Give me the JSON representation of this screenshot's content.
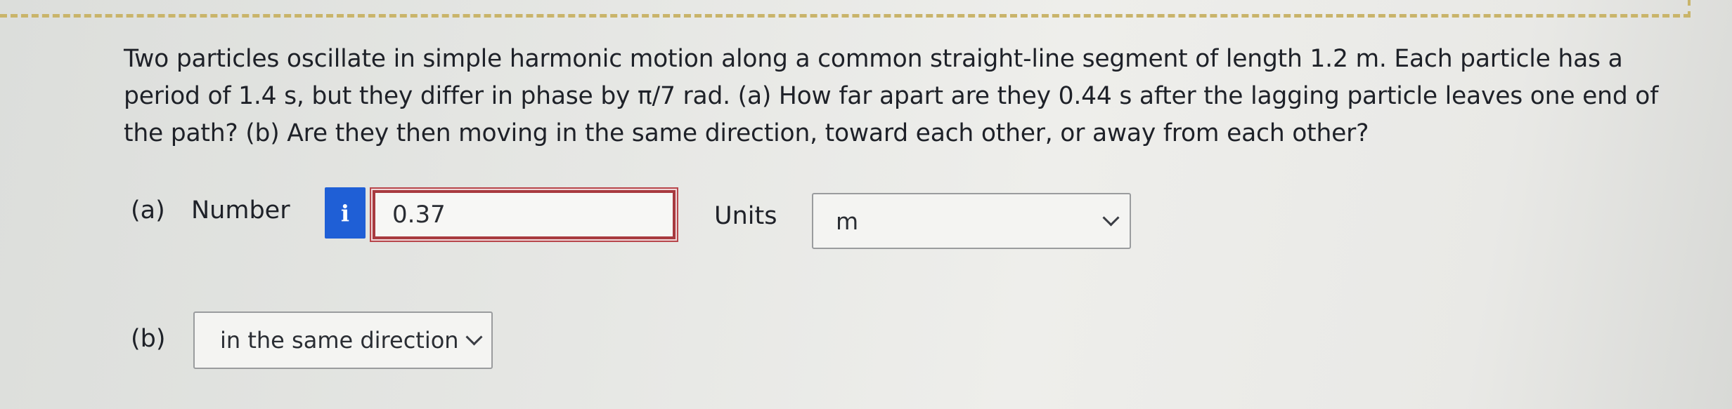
{
  "question": {
    "text": "Two particles oscillate in simple harmonic motion along a common straight-line segment of length 1.2 m. Each particle has a period of 1.4 s, but they differ in phase by π/7 rad. (a) How far apart are they 0.44 s after the lagging particle leaves one end of the path? (b) Are they then moving in the same direction, toward each other, or away from each other?"
  },
  "part_a": {
    "label": "(a)",
    "number_label": "Number",
    "info_icon": "i",
    "number_value": "0.37",
    "units_label": "Units",
    "units_value": "m"
  },
  "part_b": {
    "label": "(b)",
    "direction_value": "in the same direction"
  },
  "colors": {
    "info_button": "#1f5fd6",
    "input_error_border": "#a83a3f",
    "dashed_border": "#c9b46a"
  }
}
